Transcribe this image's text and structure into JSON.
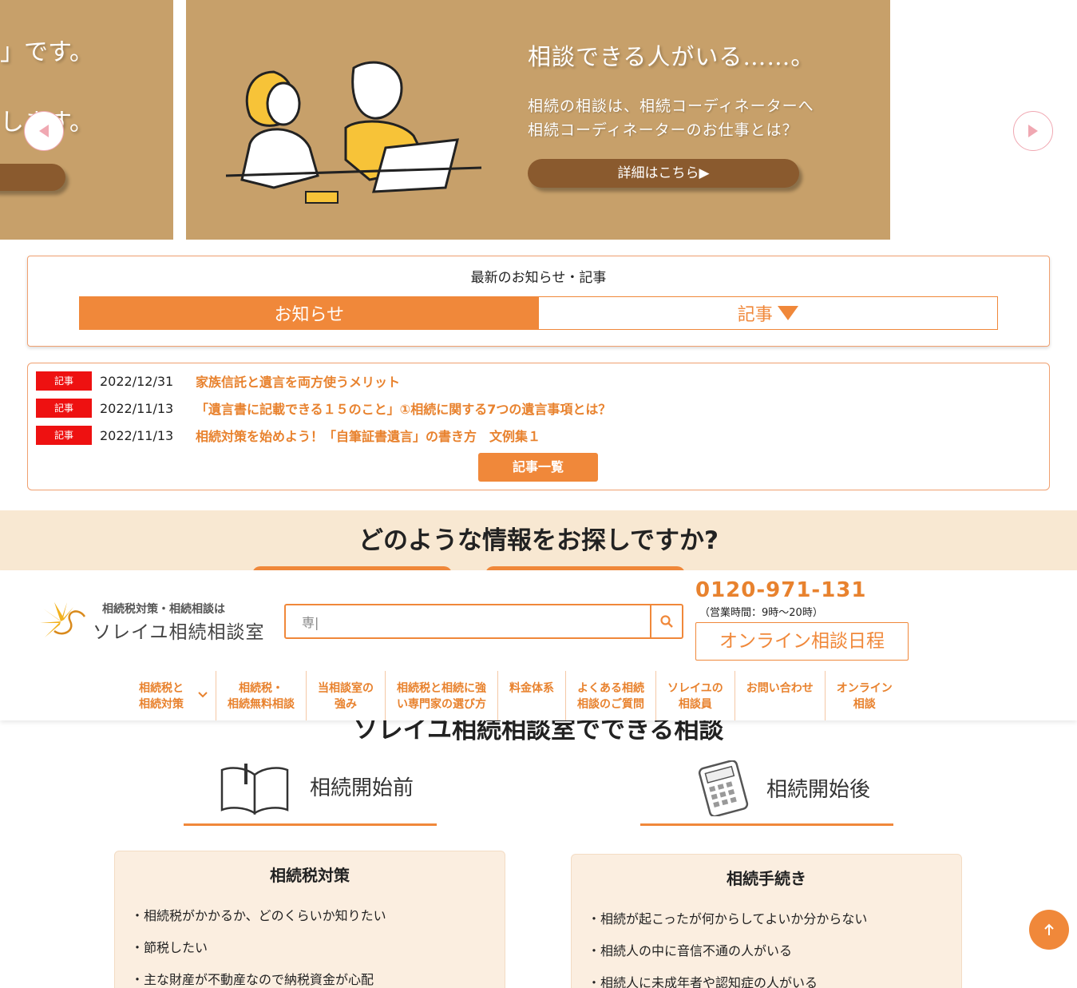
{
  "hero": {
    "prev_line1": "」です。",
    "prev_line2": "します。",
    "title": "相談できる人がいる……。",
    "line1": "相続の相談は、相続コーディネーターへ",
    "line2": "相続コーディネーターのお仕事とは？",
    "button": "詳細はこちら▶"
  },
  "news": {
    "title": "最新のお知らせ・記事",
    "tabs": [
      {
        "label": "お知らせ",
        "active": true
      },
      {
        "label": "記事",
        "active": false
      }
    ],
    "items": [
      {
        "badge": "記事",
        "date": "2022/12/31",
        "title": "家族信託と遺言を両方使うメリット"
      },
      {
        "badge": "記事",
        "date": "2022/11/13",
        "title": "「遺言書に記載できる１５のこと」①相続に関する7つの遺言事項とは？"
      },
      {
        "badge": "記事",
        "date": "2022/11/13",
        "title": "相続対策を始めよう！「自筆証書遺言」の書き方　文例集１"
      }
    ],
    "more_button": "記事一覧"
  },
  "search_section": {
    "heading": "どのような情報をお探しですか?"
  },
  "header": {
    "logo_sub": "相続税対策・相続相談は",
    "logo_main": "ソレイユ相続相談室",
    "search_value": "専|",
    "phone": "0120-971-131",
    "hours": "（営業時間：9時〜20時）",
    "online_button": "オンライン相談日程",
    "nav": [
      {
        "line1": "相続税と",
        "line2": "相続対策"
      },
      {
        "line1": "相続税・",
        "line2": "相続無料相談"
      },
      {
        "line1": "当相談室の",
        "line2": "強み"
      },
      {
        "line1": "相続税と相続に強",
        "line2": "い専門家の選び方"
      },
      {
        "line1": "料金体系",
        "line2": ""
      },
      {
        "line1": "よくある相続",
        "line2": "相談のご質問"
      },
      {
        "line1": "ソレイユの",
        "line2": "相談員"
      },
      {
        "line1": "お問い合わせ",
        "line2": ""
      },
      {
        "line1": "オンライン",
        "line2": "相談"
      }
    ]
  },
  "consult": {
    "title": "ソレイユ相続相談室でできる相談",
    "before": {
      "label": "相続開始前",
      "card_title": "相続税対策",
      "items": [
        "・相続税がかかるか、どのくらいか知りたい",
        "・節税したい",
        "・主な財産が不動産なので納税資金が心配"
      ]
    },
    "after": {
      "label": "相続開始後",
      "card_title": "相続手続き",
      "items": [
        "・相続が起こったが何からしてよいか分からない",
        "・相続人の中に音信不通の人がいる",
        "・相続人に未成年者や認知症の人がいる"
      ]
    }
  },
  "colors": {
    "accent": "#f0883a",
    "badge": "#ee1111",
    "hero_bg": "#c7a06a",
    "band_bg": "#f8e8d2",
    "card_bg": "#fbeee0"
  }
}
